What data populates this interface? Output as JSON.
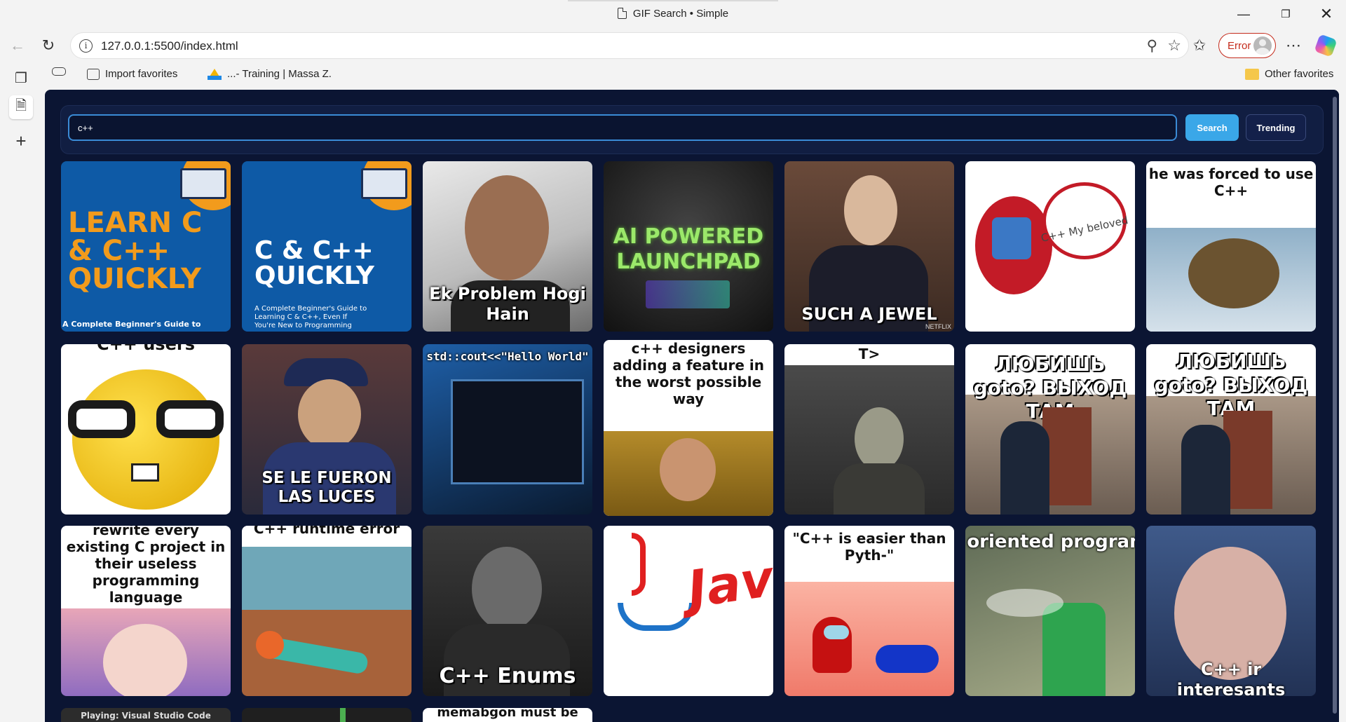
{
  "window": {
    "title": "GIF Search • Simple",
    "minimize_icon": "minimize-icon",
    "maximize_icon": "restore-icon",
    "close_icon": "close-icon"
  },
  "address_bar": {
    "url": "127.0.0.1:5500/index.html",
    "error_label": "Error"
  },
  "favorites": {
    "items": [
      {
        "label": "Import favorites",
        "icon": "import-icon"
      },
      {
        "label": "...- Training | Massa Z.",
        "icon": "google-drive-icon"
      }
    ],
    "other": "Other favorites"
  },
  "app": {
    "search_value": "c++",
    "search_button": "Search",
    "trending_button": "Trending"
  },
  "gifs": [
    {
      "caption": "LEARN C & C++ QUICKLY",
      "sub": "A Complete Beginner's Guide to"
    },
    {
      "caption": "C & C++ QUICKLY",
      "sub": "A Complete Beginner's Guide to Learning C & C++, Even If You're New to Programming"
    },
    {
      "caption": "Ek Problem Hogi Hain"
    },
    {
      "caption": "AI POWERED LAUNCHPAD"
    },
    {
      "caption": "SUCH A JEWEL",
      "badge": "NETFLIX"
    },
    {
      "caption": "C++ My beloved"
    },
    {
      "caption": "he was forced to use C++"
    },
    {
      "caption": "C++ users"
    },
    {
      "caption": "SE LE FUERON LAS LUCES"
    },
    {
      "caption": "std::cout<<\"Hello World\""
    },
    {
      "caption": "c++ designers adding a feature in the worst possible way"
    },
    {
      "caption": "T>"
    },
    {
      "caption": "ЛЮБИШЬ goto? ВЫХОД ТАМ"
    },
    {
      "caption": "ЛЮБИШЬ goto? ВЫХОД ТАМ"
    },
    {
      "caption": "rewrite every existing C project in their useless programming language"
    },
    {
      "caption": "C++ runtime error"
    },
    {
      "caption": "C++ Enums"
    },
    {
      "caption": "Java"
    },
    {
      "caption": "\"C++ is easier than Pyth-\""
    },
    {
      "caption": "t oriented program"
    },
    {
      "caption": "C++ ir interesants"
    },
    {
      "caption": "Playing: Visual Studio Code"
    },
    {
      "caption": ""
    },
    {
      "caption": "memabgon must be"
    }
  ]
}
